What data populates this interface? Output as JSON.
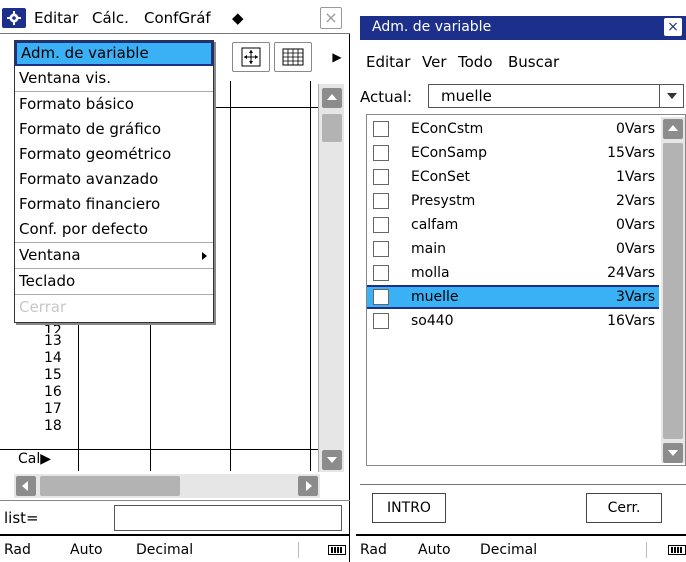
{
  "left": {
    "menubar": {
      "edit": "Editar",
      "calc": "Cálc.",
      "confgraf": "ConfGráf",
      "diamond": "◆"
    },
    "menu": {
      "items": [
        "Adm. de variable",
        "Ventana vis.",
        "Formato básico",
        "Formato de gráfico",
        "Formato geométrico",
        "Formato avanzado",
        "Formato financiero",
        "Conf. por defecto",
        "Ventana",
        "Teclado",
        "Cerrar"
      ]
    },
    "rows": [
      "12",
      "13",
      "14",
      "15",
      "16",
      "17",
      "18"
    ],
    "cal_label": "Cal▶",
    "input_label": "list=",
    "status": {
      "rad": "Rad",
      "auto": "Auto",
      "decimal": "Decimal"
    }
  },
  "right": {
    "title": "Adm. de variable",
    "menubar": {
      "edit": "Editar",
      "view": "Ver",
      "all": "Todo",
      "search": "Buscar"
    },
    "actual_label": "Actual:",
    "actual_value": "muelle",
    "variables": [
      {
        "name": "EConCstm",
        "count": "0Vars"
      },
      {
        "name": "EConSamp",
        "count": "15Vars"
      },
      {
        "name": "EConSet",
        "count": "1Vars"
      },
      {
        "name": "Presystm",
        "count": "2Vars"
      },
      {
        "name": "calfam",
        "count": "0Vars"
      },
      {
        "name": "main",
        "count": "0Vars"
      },
      {
        "name": "molla",
        "count": "24Vars"
      },
      {
        "name": "muelle",
        "count": "3Vars"
      },
      {
        "name": "so440",
        "count": "16Vars"
      }
    ],
    "buttons": {
      "intro": "INTRO",
      "close": "Cerr."
    },
    "status": {
      "rad": "Rad",
      "auto": "Auto",
      "decimal": "Decimal"
    }
  }
}
